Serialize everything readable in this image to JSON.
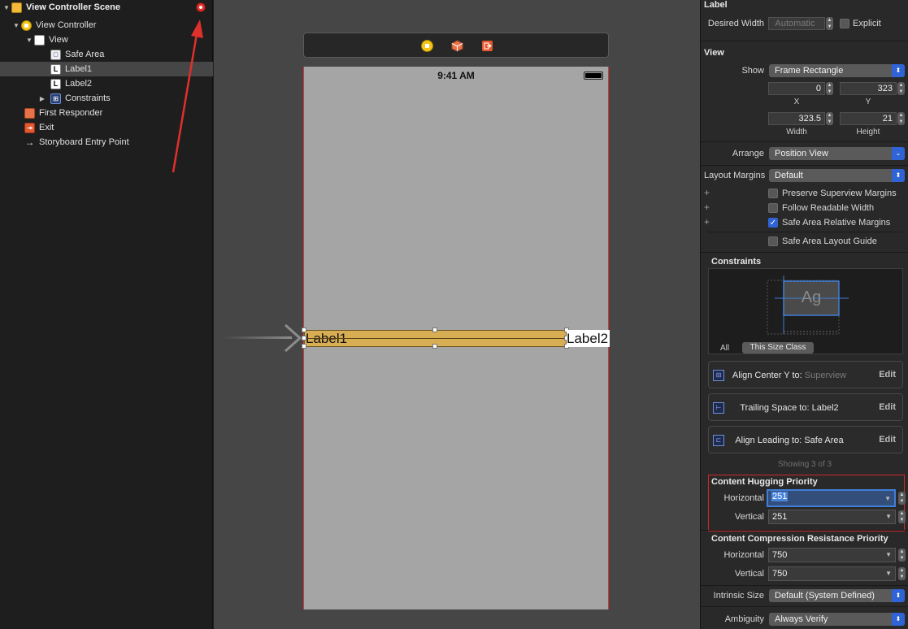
{
  "outline": {
    "rows": [
      {
        "label": "View Controller Scene"
      },
      {
        "label": "View Controller"
      },
      {
        "label": "View"
      },
      {
        "label": "Safe Area"
      },
      {
        "label": "Label1"
      },
      {
        "label": "Label2"
      },
      {
        "label": "Constraints"
      },
      {
        "label": "First Responder"
      },
      {
        "label": "Exit"
      },
      {
        "label": "Storyboard Entry Point"
      }
    ]
  },
  "canvas": {
    "status_time": "9:41 AM",
    "label1_text": "Label1",
    "label2_text": "Label2"
  },
  "inspector": {
    "label_section": {
      "title": "Label",
      "desired_width_label": "Desired Width",
      "desired_width_value": "Automatic",
      "explicit_label": "Explicit"
    },
    "view_section": {
      "title": "View",
      "show_label": "Show",
      "show_value": "Frame Rectangle",
      "x_value": "0",
      "y_value": "323",
      "x_caption": "X",
      "y_caption": "Y",
      "width_value": "323.5",
      "height_value": "21",
      "width_caption": "Width",
      "height_caption": "Height",
      "arrange_label": "Arrange",
      "arrange_value": "Position View",
      "layout_margins_label": "Layout Margins",
      "layout_margins_value": "Default",
      "checkboxes": [
        {
          "label": "Preserve Superview Margins",
          "checked": false
        },
        {
          "label": "Follow Readable Width",
          "checked": false
        },
        {
          "label": "Safe Area Relative Margins",
          "checked": true
        },
        {
          "label": "Safe Area Layout Guide",
          "checked": false
        }
      ]
    },
    "constraints_section": {
      "title": "Constraints",
      "preview_text": "Ag",
      "tab_all": "All",
      "tab_size_class": "This Size Class",
      "items": [
        {
          "label": "Align Center Y to:",
          "target": "Superview",
          "edit": "Edit"
        },
        {
          "label": "Trailing Space to:",
          "target": "Label2",
          "edit": "Edit"
        },
        {
          "label": "Align Leading to:",
          "target": "Safe Area",
          "edit": "Edit"
        }
      ],
      "showing": "Showing 3 of 3"
    },
    "hugging": {
      "title": "Content Hugging Priority",
      "horizontal_label": "Horizontal",
      "horizontal_value": "251",
      "vertical_label": "Vertical",
      "vertical_value": "251"
    },
    "compression": {
      "title": "Content Compression Resistance Priority",
      "horizontal_label": "Horizontal",
      "horizontal_value": "750",
      "vertical_label": "Vertical",
      "vertical_value": "750"
    },
    "intrinsic_label": "Intrinsic Size",
    "intrinsic_value": "Default (System Defined)",
    "ambiguity_label": "Ambiguity",
    "ambiguity_value": "Always Verify"
  },
  "colors": {
    "accent_blue": "#2f63d6",
    "annotation_red": "#e0302b",
    "label1_fill": "#d8ae55"
  }
}
